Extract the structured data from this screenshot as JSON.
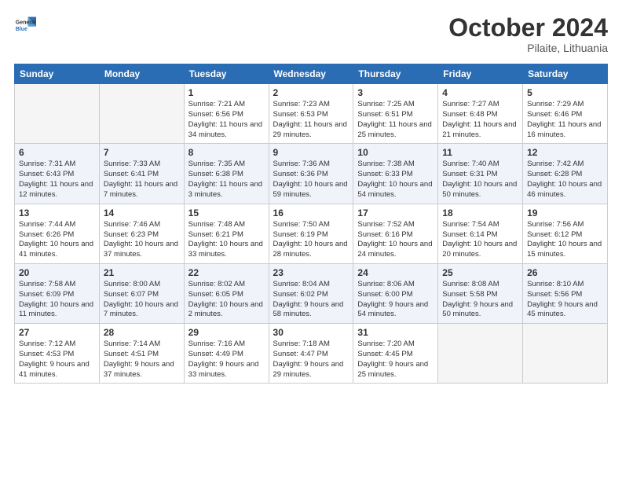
{
  "header": {
    "logo_line1": "General",
    "logo_line2": "Blue",
    "month": "October 2024",
    "location": "Pilaite, Lithuania"
  },
  "weekdays": [
    "Sunday",
    "Monday",
    "Tuesday",
    "Wednesday",
    "Thursday",
    "Friday",
    "Saturday"
  ],
  "weeks": [
    [
      {
        "day": "",
        "empty": true
      },
      {
        "day": "",
        "empty": true
      },
      {
        "day": "1",
        "sunrise": "7:21 AM",
        "sunset": "6:56 PM",
        "daylight": "11 hours and 34 minutes."
      },
      {
        "day": "2",
        "sunrise": "7:23 AM",
        "sunset": "6:53 PM",
        "daylight": "11 hours and 29 minutes."
      },
      {
        "day": "3",
        "sunrise": "7:25 AM",
        "sunset": "6:51 PM",
        "daylight": "11 hours and 25 minutes."
      },
      {
        "day": "4",
        "sunrise": "7:27 AM",
        "sunset": "6:48 PM",
        "daylight": "11 hours and 21 minutes."
      },
      {
        "day": "5",
        "sunrise": "7:29 AM",
        "sunset": "6:46 PM",
        "daylight": "11 hours and 16 minutes."
      }
    ],
    [
      {
        "day": "6",
        "sunrise": "7:31 AM",
        "sunset": "6:43 PM",
        "daylight": "11 hours and 12 minutes."
      },
      {
        "day": "7",
        "sunrise": "7:33 AM",
        "sunset": "6:41 PM",
        "daylight": "11 hours and 7 minutes."
      },
      {
        "day": "8",
        "sunrise": "7:35 AM",
        "sunset": "6:38 PM",
        "daylight": "11 hours and 3 minutes."
      },
      {
        "day": "9",
        "sunrise": "7:36 AM",
        "sunset": "6:36 PM",
        "daylight": "10 hours and 59 minutes."
      },
      {
        "day": "10",
        "sunrise": "7:38 AM",
        "sunset": "6:33 PM",
        "daylight": "10 hours and 54 minutes."
      },
      {
        "day": "11",
        "sunrise": "7:40 AM",
        "sunset": "6:31 PM",
        "daylight": "10 hours and 50 minutes."
      },
      {
        "day": "12",
        "sunrise": "7:42 AM",
        "sunset": "6:28 PM",
        "daylight": "10 hours and 46 minutes."
      }
    ],
    [
      {
        "day": "13",
        "sunrise": "7:44 AM",
        "sunset": "6:26 PM",
        "daylight": "10 hours and 41 minutes."
      },
      {
        "day": "14",
        "sunrise": "7:46 AM",
        "sunset": "6:23 PM",
        "daylight": "10 hours and 37 minutes."
      },
      {
        "day": "15",
        "sunrise": "7:48 AM",
        "sunset": "6:21 PM",
        "daylight": "10 hours and 33 minutes."
      },
      {
        "day": "16",
        "sunrise": "7:50 AM",
        "sunset": "6:19 PM",
        "daylight": "10 hours and 28 minutes."
      },
      {
        "day": "17",
        "sunrise": "7:52 AM",
        "sunset": "6:16 PM",
        "daylight": "10 hours and 24 minutes."
      },
      {
        "day": "18",
        "sunrise": "7:54 AM",
        "sunset": "6:14 PM",
        "daylight": "10 hours and 20 minutes."
      },
      {
        "day": "19",
        "sunrise": "7:56 AM",
        "sunset": "6:12 PM",
        "daylight": "10 hours and 15 minutes."
      }
    ],
    [
      {
        "day": "20",
        "sunrise": "7:58 AM",
        "sunset": "6:09 PM",
        "daylight": "10 hours and 11 minutes."
      },
      {
        "day": "21",
        "sunrise": "8:00 AM",
        "sunset": "6:07 PM",
        "daylight": "10 hours and 7 minutes."
      },
      {
        "day": "22",
        "sunrise": "8:02 AM",
        "sunset": "6:05 PM",
        "daylight": "10 hours and 2 minutes."
      },
      {
        "day": "23",
        "sunrise": "8:04 AM",
        "sunset": "6:02 PM",
        "daylight": "9 hours and 58 minutes."
      },
      {
        "day": "24",
        "sunrise": "8:06 AM",
        "sunset": "6:00 PM",
        "daylight": "9 hours and 54 minutes."
      },
      {
        "day": "25",
        "sunrise": "8:08 AM",
        "sunset": "5:58 PM",
        "daylight": "9 hours and 50 minutes."
      },
      {
        "day": "26",
        "sunrise": "8:10 AM",
        "sunset": "5:56 PM",
        "daylight": "9 hours and 45 minutes."
      }
    ],
    [
      {
        "day": "27",
        "sunrise": "7:12 AM",
        "sunset": "4:53 PM",
        "daylight": "9 hours and 41 minutes."
      },
      {
        "day": "28",
        "sunrise": "7:14 AM",
        "sunset": "4:51 PM",
        "daylight": "9 hours and 37 minutes."
      },
      {
        "day": "29",
        "sunrise": "7:16 AM",
        "sunset": "4:49 PM",
        "daylight": "9 hours and 33 minutes."
      },
      {
        "day": "30",
        "sunrise": "7:18 AM",
        "sunset": "4:47 PM",
        "daylight": "9 hours and 29 minutes."
      },
      {
        "day": "31",
        "sunrise": "7:20 AM",
        "sunset": "4:45 PM",
        "daylight": "9 hours and 25 minutes."
      },
      {
        "day": "",
        "empty": true
      },
      {
        "day": "",
        "empty": true
      }
    ]
  ]
}
